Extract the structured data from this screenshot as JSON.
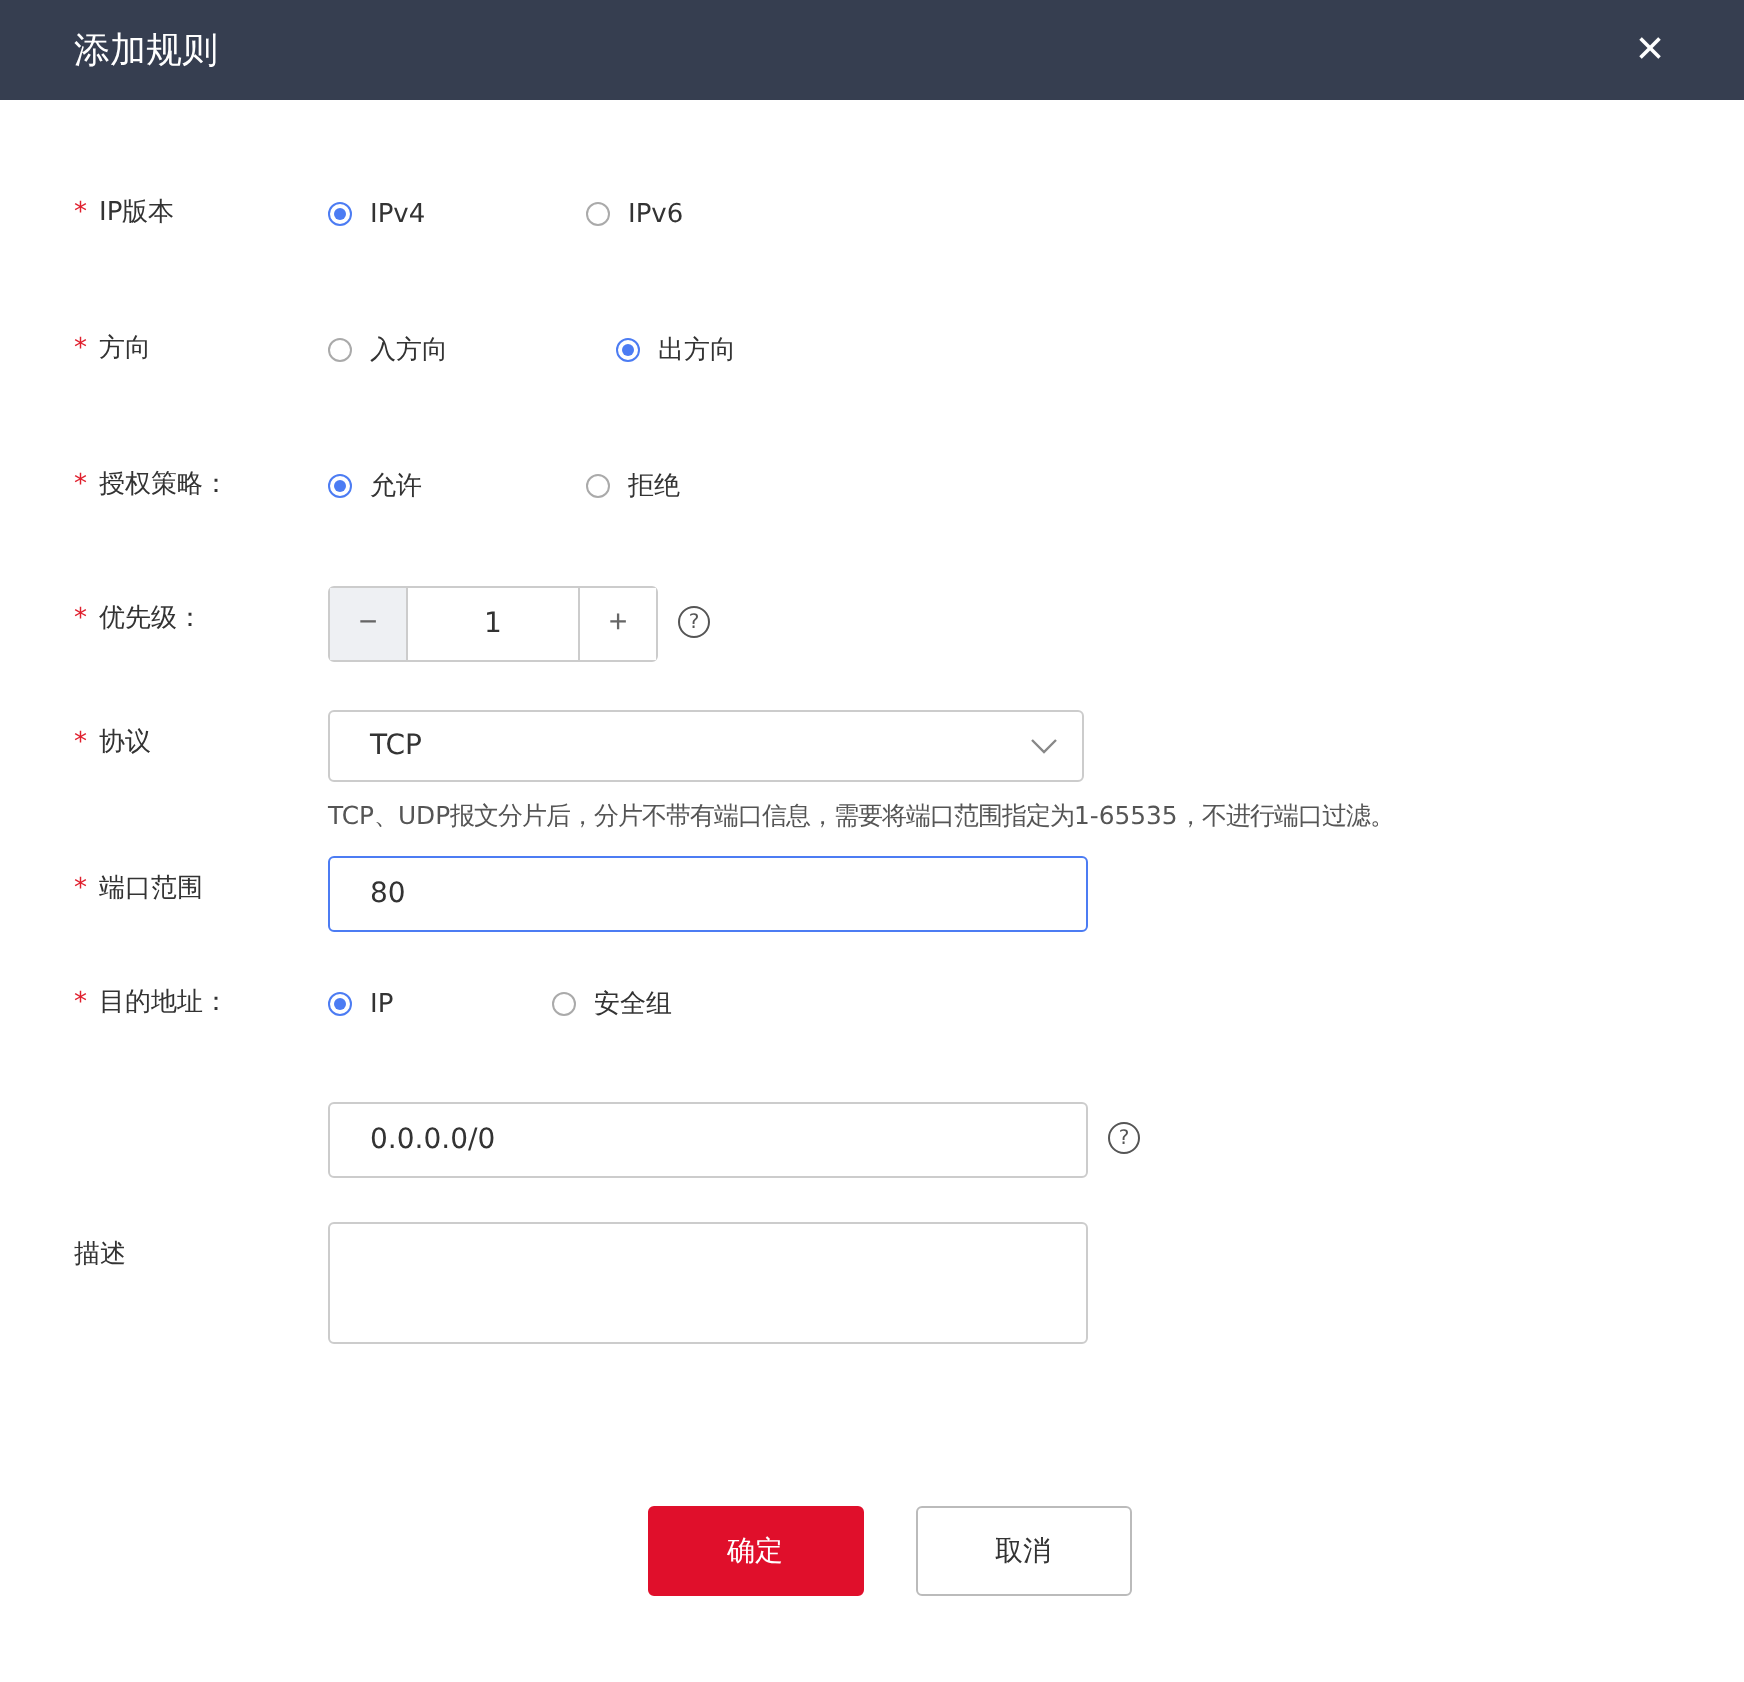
{
  "dialog": {
    "title": "添加规则",
    "close": "×"
  },
  "fields": [
    {
      "kind": "radio",
      "required_mark": "*",
      "label": "IP版本",
      "options": [
        {
          "label": "IPv4",
          "selected": true
        },
        {
          "label": "IPv6",
          "selected": false
        }
      ]
    },
    {
      "kind": "radio",
      "required_mark": "*",
      "label": "方向",
      "options": [
        {
          "label": "入方向",
          "selected": false
        },
        {
          "label": "出方向",
          "selected": true
        }
      ]
    },
    {
      "kind": "radio",
      "required_mark": "*",
      "label": "授权策略：",
      "options": [
        {
          "label": "允许",
          "selected": true
        },
        {
          "label": "拒绝",
          "selected": false
        }
      ]
    },
    {
      "kind": "stepper",
      "required_mark": "*",
      "label": "优先级：",
      "minus": "−",
      "value": "1",
      "plus": "+",
      "help": "?"
    },
    {
      "kind": "select",
      "required_mark": "*",
      "label": "协议",
      "value": "TCP",
      "hint": "TCP、UDP报文分片后，分片不带有端口信息，需要将端口范围指定为1-65535，不进行端口过滤。"
    },
    {
      "kind": "input",
      "required_mark": "*",
      "label": "端口范围",
      "value": "80",
      "focused": true
    },
    {
      "kind": "radio",
      "required_mark": "*",
      "label": "目的地址：",
      "options": [
        {
          "label": "IP",
          "selected": true
        },
        {
          "label": "安全组",
          "selected": false
        }
      ]
    },
    {
      "kind": "input",
      "value": "0.0.0.0/0",
      "focused": false,
      "help": "?"
    },
    {
      "kind": "textarea",
      "label": "描述"
    }
  ],
  "buttons": [
    {
      "label": "确定",
      "primary": true
    },
    {
      "label": "取消",
      "primary": false
    }
  ]
}
